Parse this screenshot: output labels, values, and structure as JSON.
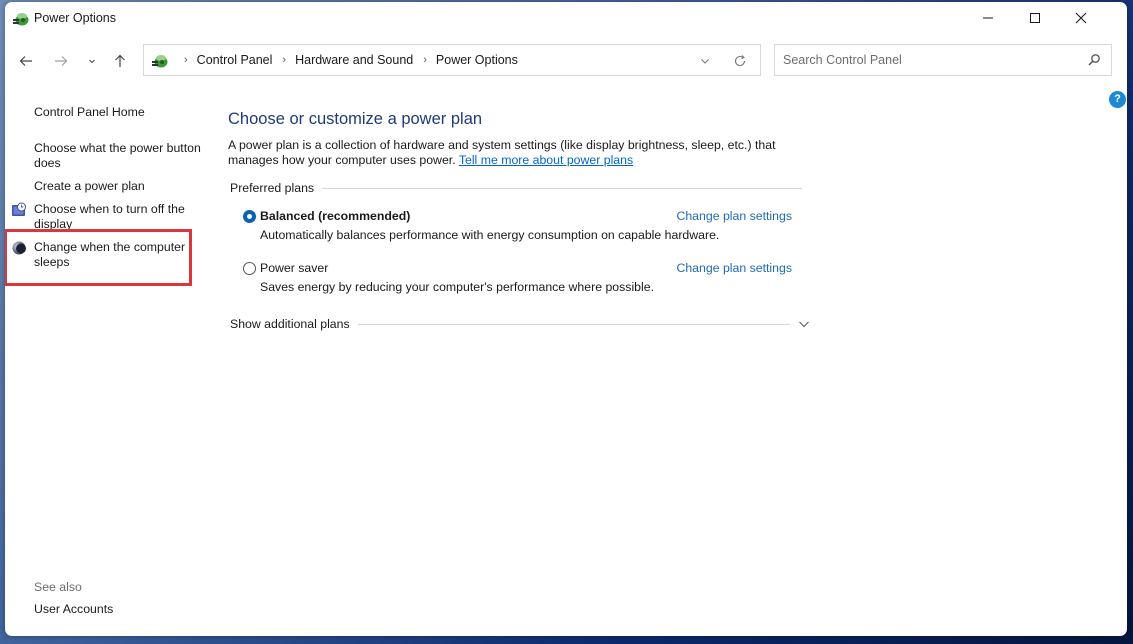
{
  "window": {
    "title": "Power Options",
    "icon": "power-options-icon"
  },
  "window_controls": {
    "minimize": "minimize-icon",
    "maximize": "maximize-icon",
    "close": "close-icon"
  },
  "navigation": {
    "back": "arrow-left-icon",
    "forward": "arrow-right-icon",
    "recent": "chevron-down-icon",
    "up": "arrow-up-icon"
  },
  "address_bar": {
    "icon": "control-panel-icon",
    "breadcrumbs": [
      "Control Panel",
      "Hardware and Sound",
      "Power Options"
    ],
    "separator": "›",
    "dropdown_icon": "chevron-down-icon",
    "refresh_icon": "refresh-icon"
  },
  "search": {
    "placeholder": "Search Control Panel",
    "value": "",
    "icon": "search-icon"
  },
  "help": {
    "label": "?"
  },
  "sidebar": {
    "home": "Control Panel Home",
    "items": [
      {
        "label": "Choose what the power button does",
        "icon": null
      },
      {
        "label": "Create a power plan",
        "icon": null
      },
      {
        "label": "Choose when to turn off the display",
        "icon": "display-clock-icon"
      },
      {
        "label": "Change when the computer sleeps",
        "icon": "moon-sleep-icon",
        "highlighted": true
      }
    ],
    "see_also_label": "See also",
    "see_also_items": [
      "User Accounts"
    ]
  },
  "main": {
    "title": "Choose or customize a power plan",
    "intro_text": "A power plan is a collection of hardware and system settings (like display brightness, sleep, etc.) that manages how your computer uses power.",
    "intro_link": "Tell me more about power plans",
    "preferred_plans_label": "Preferred plans",
    "plans": [
      {
        "name": "Balanced (recommended)",
        "description": "Automatically balances performance with energy consumption on capable hardware.",
        "selected": true,
        "link": "Change plan settings"
      },
      {
        "name": "Power saver",
        "description": "Saves energy by reducing your computer's performance where possible.",
        "selected": false,
        "link": "Change plan settings"
      }
    ],
    "show_additional_label": "Show additional plans"
  },
  "colors": {
    "title_blue": "#1e3c78",
    "link_blue": "#1e6ab6",
    "highlight_red": "#d9363e",
    "radio_blue": "#0b63b7"
  }
}
